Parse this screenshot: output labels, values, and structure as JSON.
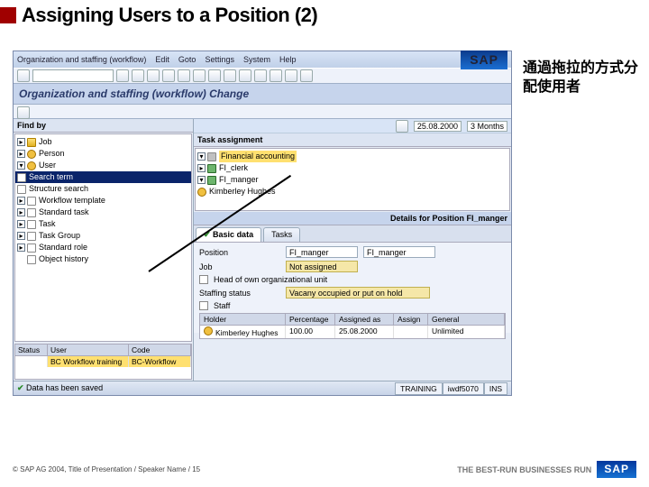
{
  "slide": {
    "title": "Assigning Users to a Position (2)",
    "cjk_note": "通過拖拉的方式分配使用者"
  },
  "menu": {
    "i0": "Organization and staffing (workflow)",
    "i1": "Edit",
    "i2": "Goto",
    "i3": "Settings",
    "i4": "System",
    "i5": "Help",
    "brand": "SAP"
  },
  "window_title": "Organization and staffing (workflow) Change",
  "date_field": "25.08.2000",
  "period_field": "3 Months",
  "left": {
    "find_label": "Find by",
    "n0": "Job",
    "n1": "Person",
    "n2": "User",
    "n2a": "Search term",
    "n2b": "Structure search",
    "n3": "Workflow template",
    "n4": "Standard task",
    "n5": "Task",
    "n6": "Task Group",
    "n7": "Standard role",
    "n8": "Object history",
    "gh0": "Status",
    "gh1": "User",
    "gh2": "Code",
    "gr0": "BC Workflow training",
    "gr1": "BC-Workflow"
  },
  "right": {
    "task_label": "Task assignment",
    "t0": "Financial accounting",
    "t1": "FI_clerk",
    "t2": "FI_manger",
    "t3": "Kimberley Hughes",
    "details_label": "Details for Position FI_manger",
    "tab_basic": "Basic data",
    "tab_tasks": "Tasks",
    "f_position": "Position",
    "v_position1": "FI_manger",
    "v_position2": "FI_manger",
    "f_job": "Job",
    "v_job": "Not assigned",
    "f_head": "Head of own organizational unit",
    "f_staff_status": "Staffing status",
    "v_staff_status": "Vacany occupied or put on hold",
    "f_staff": "Staff",
    "sh0": "Holder",
    "sh1": "Percentage",
    "sh2": "Assigned as",
    "sh3": "Assign",
    "sh4": "General",
    "sr_holder": "Kimberley Hughes",
    "sr_pct": "100.00",
    "sr_date": "25.08.2000",
    "sr_unlim": "Unlimited"
  },
  "status": {
    "msg": "Data has been saved",
    "s0": "TRAINING",
    "s1": "iwdf5070",
    "s2": "INS"
  },
  "footer": {
    "copyright": "©  SAP AG 2004, Title of Presentation / Speaker Name / 15",
    "tagline": "THE BEST-RUN BUSINESSES RUN",
    "brand": "SAP"
  },
  "chart_data": null
}
